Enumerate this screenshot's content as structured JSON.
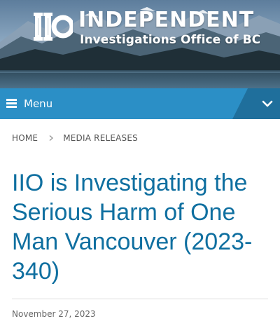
{
  "header": {
    "logo_title": "INDEPENDENT",
    "logo_subtitle": "Investigations Office of BC",
    "logo_mark_text": "IIO"
  },
  "nav": {
    "menu_label": "Menu",
    "toggle_icon": "chevron-down-icon",
    "menu_icon": "hamburger-icon"
  },
  "breadcrumb": {
    "items": [
      "HOME",
      "MEDIA RELEASES"
    ],
    "separator_icon": "chevron-right-icon"
  },
  "article": {
    "title": "IIO is Investigating the Serious Harm of One Man Vancouver (2023-340)",
    "date": "November 27, 2023"
  },
  "colors": {
    "accent": "#2b8fc6",
    "title": "#0f6fa0",
    "toggle_bg": "#1f6f9c"
  }
}
